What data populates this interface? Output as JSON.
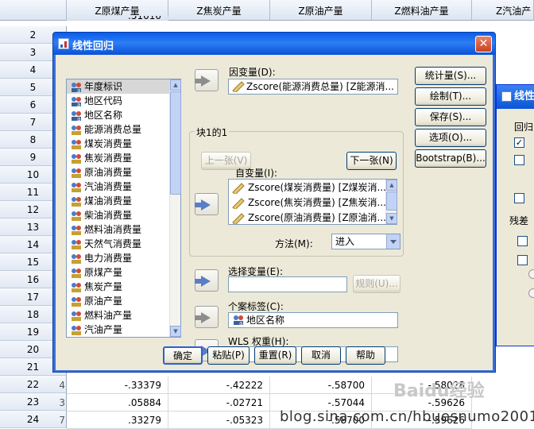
{
  "spreadsheet": {
    "headers": [
      "Z原煤产量",
      "Z焦炭产量",
      "Z原油产量",
      "Z燃料油产量",
      "Z汽油产"
    ],
    "row_numbers": [
      "2",
      "3",
      "4",
      "5",
      "6",
      "7",
      "8",
      "9",
      "10",
      "11",
      "12",
      "13",
      "14",
      "15",
      "16",
      "17",
      "18",
      "19",
      "20",
      "21",
      "22",
      "23",
      "24"
    ],
    "top_partial": [
      ".51010",
      ".40235",
      ".55755",
      ".71157"
    ],
    "rows": [
      {
        "num": "22",
        "prefix": "4",
        "cells": [
          "-.33379",
          "-.42222",
          "-.58700",
          "-.58028"
        ]
      },
      {
        "num": "23",
        "prefix": "3",
        "cells": [
          ".05884",
          "-.02721",
          "-.57044",
          "-.59626"
        ]
      },
      {
        "num": "24",
        "prefix": "7",
        "cells": [
          ".33279",
          "-.05323",
          "-.58700",
          "-.59626"
        ]
      }
    ]
  },
  "dialog": {
    "title": "线性回归",
    "close_label": "✕",
    "variables": [
      "年度标识",
      "地区代码",
      "地区名称",
      "能源消费总量",
      "煤炭消费量",
      "焦炭消费量",
      "原油消费量",
      "汽油消费量",
      "煤油消费量",
      "柴油消费量",
      "燃料油消费量",
      "天然气消费量",
      "电力消费量",
      "原煤产量",
      "焦炭产量",
      "原油产量",
      "燃料油产量",
      "汽油产量"
    ],
    "dependent_label": "因变量(D):",
    "dependent_value": "Zscore(能源消费总量) [Z能源消...",
    "block_label": "块1的1",
    "prev_label": "上一张(V)",
    "next_label": "下一张(N)",
    "independent_label": "自变量(I):",
    "independents": [
      "Zscore(煤炭消费量) [Z煤炭消...",
      "Zscore(焦炭消费量) [Z焦炭消...",
      "Zscore(原油消费量) [Z原油消..."
    ],
    "method_label": "方法(M):",
    "method_value": "进入",
    "selection_label": "选择变量(E):",
    "rule_label": "规则(U)...",
    "case_label": "个案标签(C):",
    "case_value": "地区名称",
    "wls_label": "WLS 权重(H):",
    "side_buttons": [
      "统计量(S)...",
      "绘制(T)...",
      "保存(S)...",
      "选项(O)...",
      "Bootstrap(B)..."
    ],
    "bottom_buttons": [
      "确定",
      "粘贴(P)",
      "重置(R)",
      "取消",
      "帮助"
    ]
  },
  "dialog2": {
    "title": "线性",
    "labels": [
      "回归",
      "残差"
    ]
  },
  "watermark": {
    "site": "Baidu经验",
    "blog": "blog.sina.com.cn/hbuesnumo2001"
  }
}
